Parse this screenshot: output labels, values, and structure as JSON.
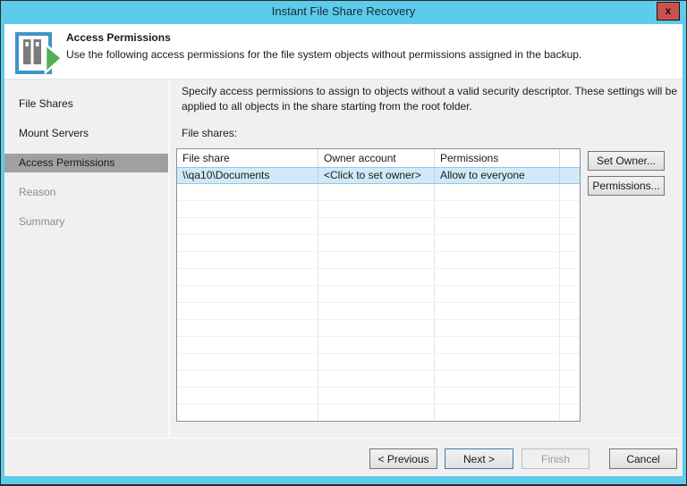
{
  "window": {
    "title": "Instant File Share Recovery",
    "close_glyph": "x"
  },
  "header": {
    "title": "Access Permissions",
    "description": "Use the following access permissions for the file system objects without permissions assigned in the backup."
  },
  "sidebar": {
    "items": [
      {
        "label": "File Shares",
        "state": "done"
      },
      {
        "label": "Mount Servers",
        "state": "done"
      },
      {
        "label": "Access Permissions",
        "state": "active"
      },
      {
        "label": "Reason",
        "state": "pending"
      },
      {
        "label": "Summary",
        "state": "pending"
      }
    ]
  },
  "main": {
    "instruction": "Specify access permissions to assign to objects without a valid security descriptor. These settings will be applied to all objects in the share starting from the root folder.",
    "list_label": "File shares:",
    "table": {
      "columns": [
        "File share",
        "Owner account",
        "Permissions"
      ],
      "rows": [
        [
          "\\\\qa10\\Documents",
          "<Click to set owner>",
          "Allow to everyone"
        ]
      ],
      "empty_row_count": 15
    },
    "side_buttons": [
      {
        "label": "Set Owner...",
        "state": "enabled"
      },
      {
        "label": "Permissions...",
        "state": "enabled"
      }
    ]
  },
  "footer": {
    "buttons": [
      {
        "label": "< Previous",
        "state": "enabled"
      },
      {
        "label": "Next >",
        "state": "default"
      },
      {
        "label": "Finish",
        "state": "disabled"
      },
      {
        "label": "Cancel",
        "state": "enabled"
      }
    ]
  },
  "colors": {
    "titlebar_blue": "#5FCBEA",
    "close_red": "#C85250",
    "selected_row_blue": "#D2E9F8",
    "active_step_gray": "#A0A0A0",
    "icon_border_blue": "#3E96C6",
    "icon_arrow_green": "#54B054",
    "icon_bar_gray": "#7B7B7B"
  }
}
